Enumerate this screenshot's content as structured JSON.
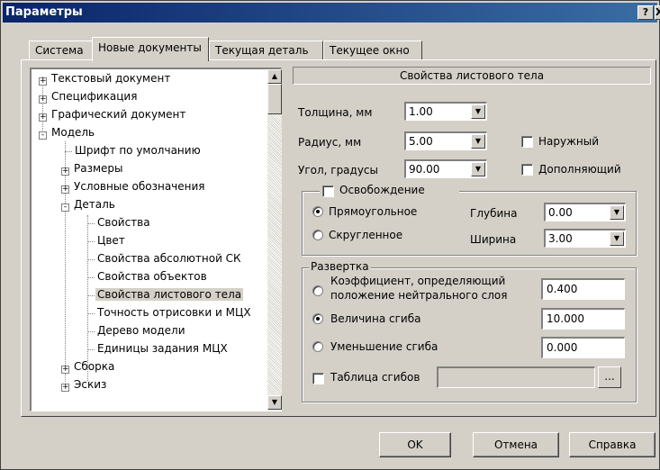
{
  "window": {
    "title": "Параметры",
    "help_glyph": "?",
    "close_glyph": "X"
  },
  "tabs": [
    "Система",
    "Новые документы",
    "Текущая деталь",
    "Текущее окно"
  ],
  "tree": {
    "items": [
      {
        "label": "Текстовый документ",
        "level": 0,
        "toggle": "+"
      },
      {
        "label": "Спецификация",
        "level": 0,
        "toggle": "+"
      },
      {
        "label": "Графический документ",
        "level": 0,
        "toggle": "+"
      },
      {
        "label": "Модель",
        "level": 0,
        "toggle": "-"
      },
      {
        "label": "Шрифт по умолчанию",
        "level": 1,
        "toggle": ""
      },
      {
        "label": "Размеры",
        "level": 1,
        "toggle": "+"
      },
      {
        "label": "Условные обозначения",
        "level": 1,
        "toggle": "+"
      },
      {
        "label": "Деталь",
        "level": 1,
        "toggle": "-"
      },
      {
        "label": "Свойства",
        "level": 2,
        "toggle": ""
      },
      {
        "label": "Цвет",
        "level": 2,
        "toggle": ""
      },
      {
        "label": "Свойства абсолютной СК",
        "level": 2,
        "toggle": ""
      },
      {
        "label": "Свойства объектов",
        "level": 2,
        "toggle": ""
      },
      {
        "label": "Свойства листового тела",
        "level": 2,
        "toggle": "",
        "selected": true
      },
      {
        "label": "Точность отрисовки и МЦХ",
        "level": 2,
        "toggle": ""
      },
      {
        "label": "Дерево модели",
        "level": 2,
        "toggle": ""
      },
      {
        "label": "Единицы задания МЦХ",
        "level": 2,
        "toggle": ""
      },
      {
        "label": "Сборка",
        "level": 1,
        "toggle": "+"
      },
      {
        "label": "Эскиз",
        "level": 1,
        "toggle": "+"
      }
    ]
  },
  "panel": {
    "header": "Свойства листового тела",
    "thickness": {
      "label": "Толщина, мм",
      "value": "1.00"
    },
    "radius": {
      "label": "Радиус, мм",
      "value": "5.00"
    },
    "angle": {
      "label": "Угол, градусы",
      "value": "90.00"
    },
    "outer_check": {
      "label": "Наружный",
      "checked": false
    },
    "complement_check": {
      "label": "Дополняющий",
      "checked": false
    },
    "relief": {
      "label": "Освобождение",
      "checked": false,
      "rect": {
        "label": "Прямоугольное",
        "checked": true
      },
      "round": {
        "label": "Скругленное",
        "checked": false
      },
      "depth": {
        "label": "Глубина",
        "value": "0.00"
      },
      "width": {
        "label": "Ширина",
        "value": "3.00"
      }
    },
    "unfold": {
      "title": "Развертка",
      "coef": {
        "label_line1": "Коэффициент, определяющий",
        "label_line2": "положение нейтрального слоя",
        "value": "0.400",
        "checked": false
      },
      "bend_value": {
        "label": "Величина сгиба",
        "value": "10.000",
        "checked": true
      },
      "bend_reduce": {
        "label": "Уменьшение сгиба",
        "value": "0.000",
        "checked": false
      },
      "table": {
        "label": "Таблица сгибов",
        "value": "",
        "browse": "...",
        "checked": false
      }
    }
  },
  "buttons": {
    "ok": "OK",
    "cancel": "Отмена",
    "help": "Справка"
  }
}
